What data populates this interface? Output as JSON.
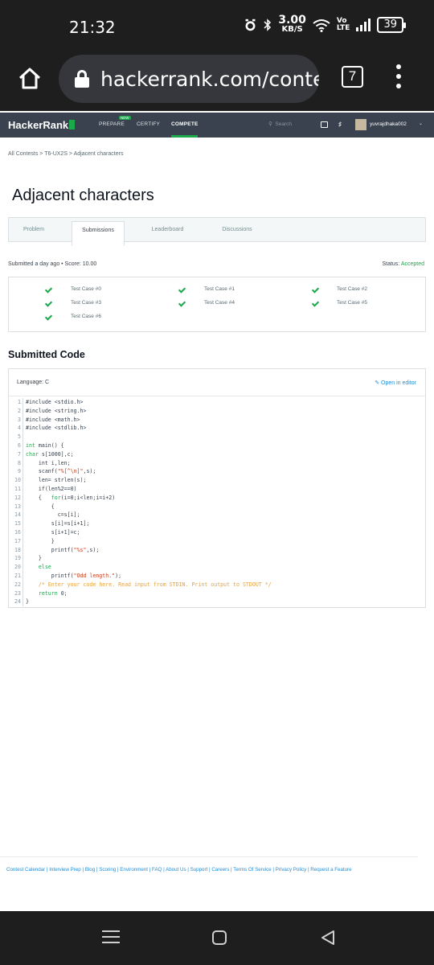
{
  "status_bar": {
    "time": "21:32",
    "speed_value": "3.00",
    "speed_unit": "KB/S",
    "volte_top": "Vo",
    "volte_bottom": "LTE",
    "battery": "39"
  },
  "browser": {
    "url": "hackerrank.com/contest",
    "tab_count": "7"
  },
  "hr_nav": {
    "logo": "HackerRank",
    "new_badge": "NEW",
    "items": [
      "PREPARE",
      "CERTIFY",
      "COMPETE"
    ],
    "search_placeholder": "Search",
    "username": "yuvrajdhaka002"
  },
  "breadcrumb": "All Contests  >  T6-UX2S  >  Adjacent characters",
  "title": "Adjacent characters",
  "tabs": [
    "Problem",
    "Submissions",
    "Leaderboard",
    "Discussions"
  ],
  "submission": {
    "info": "Submitted a day ago • Score: 10.00",
    "status_label": "Status: ",
    "status_value": "Accepted"
  },
  "test_cases": [
    "Test Case #0",
    "Test Case #1",
    "Test Case #2",
    "Test Case #3",
    "Test Case #4",
    "Test Case #5",
    "Test Case #6"
  ],
  "submitted_code_title": "Submitted Code",
  "code_panel": {
    "language": "Language: C",
    "open_in_editor": "Open in editor"
  },
  "footer": "Contest Calendar | Interview Prep | Blog | Scoring | Environment | FAQ | About Us | Support | Careers | Terms Of Service | Privacy Policy | Request a Feature",
  "colors": {
    "accent_green": "#1ba94c",
    "nav_bg": "#39424e",
    "link_blue": "#1f8dd6"
  },
  "icons": [
    "home-icon",
    "lock-icon",
    "tabs-icon",
    "more-icon",
    "search-icon",
    "chat-icon",
    "bell-icon",
    "check-icon",
    "edit-icon",
    "menu-icon",
    "home-square-icon",
    "back-icon"
  ]
}
